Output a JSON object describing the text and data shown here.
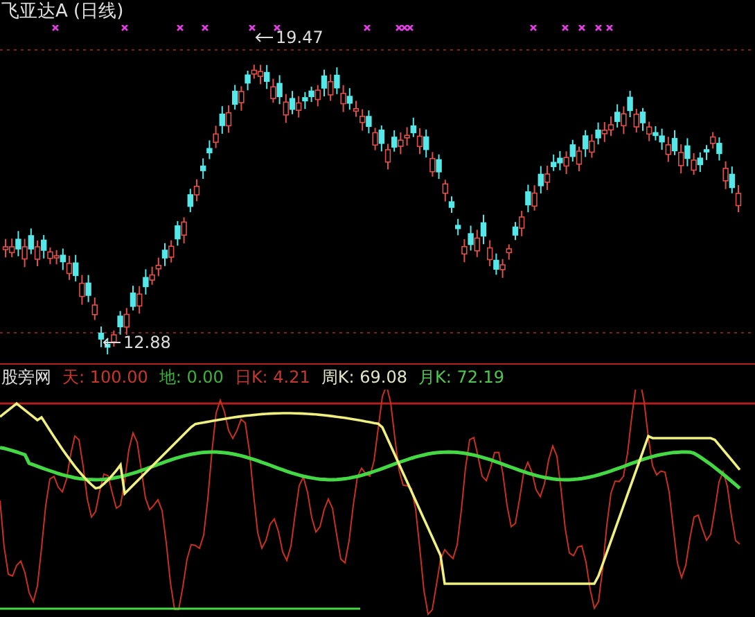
{
  "title": "飞亚达A (日线)",
  "price_chart": {
    "annotations": [
      {
        "kind": "high",
        "text": "19.47"
      },
      {
        "kind": "low",
        "text": "12.88"
      }
    ]
  },
  "indicator": {
    "name": "股旁网",
    "legend": [
      {
        "text": "天: 100.00",
        "color": "#c8372d"
      },
      {
        "text": "地: 0.00",
        "color": "#3cb43c"
      },
      {
        "text": "日K: 4.21",
        "color": "#c8372d"
      },
      {
        "text": "周K: 69.08",
        "color": "#e6e6c8"
      },
      {
        "text": "月K: 72.19",
        "color": "#50c850"
      }
    ]
  }
}
